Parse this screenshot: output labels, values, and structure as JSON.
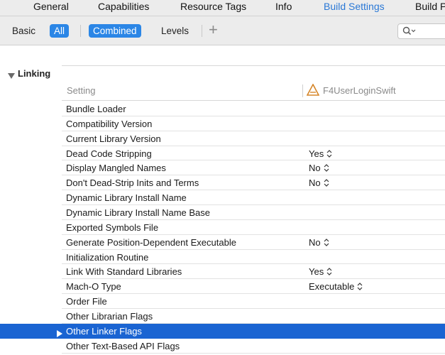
{
  "tabs": [
    {
      "label": "General",
      "active": false
    },
    {
      "label": "Capabilities",
      "active": false
    },
    {
      "label": "Resource Tags",
      "active": false
    },
    {
      "label": "Info",
      "active": false
    },
    {
      "label": "Build Settings",
      "active": true
    },
    {
      "label": "Build P",
      "active": false
    }
  ],
  "filters": {
    "basic": "Basic",
    "all": "All",
    "combined": "Combined",
    "levels": "Levels",
    "add": "+"
  },
  "section": {
    "title": "Linking",
    "column_setting": "Setting",
    "column_target": "F4UserLoginSwift"
  },
  "rows": [
    {
      "name": "Bundle Loader",
      "value": ""
    },
    {
      "name": "Compatibility Version",
      "value": ""
    },
    {
      "name": "Current Library Version",
      "value": ""
    },
    {
      "name": "Dead Code Stripping",
      "value": "Yes"
    },
    {
      "name": "Display Mangled Names",
      "value": "No"
    },
    {
      "name": "Don't Dead-Strip Inits and Terms",
      "value": "No"
    },
    {
      "name": "Dynamic Library Install Name",
      "value": ""
    },
    {
      "name": "Dynamic Library Install Name Base",
      "value": ""
    },
    {
      "name": "Exported Symbols File",
      "value": ""
    },
    {
      "name": "Generate Position-Dependent Executable",
      "value": "No"
    },
    {
      "name": "Initialization Routine",
      "value": ""
    },
    {
      "name": "Link With Standard Libraries",
      "value": "Yes"
    },
    {
      "name": "Mach-O Type",
      "value": "Executable"
    },
    {
      "name": "Order File",
      "value": ""
    },
    {
      "name": "Other Librarian Flags",
      "value": ""
    },
    {
      "name": "Other Linker Flags",
      "value": "",
      "selected": true,
      "expandable": true
    },
    {
      "name": "Other Text-Based API Flags",
      "value": ""
    }
  ],
  "colors": {
    "accent": "#2b86e6",
    "selection": "#1a64d2",
    "active_tab": "#2a78d6"
  }
}
